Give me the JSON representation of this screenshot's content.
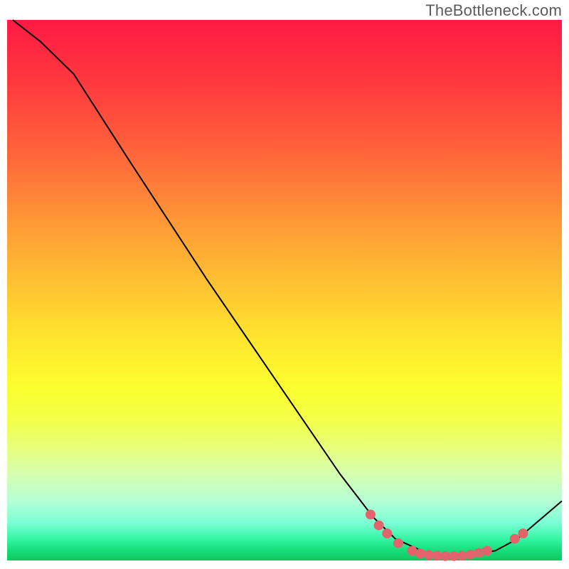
{
  "watermark": "TheBottleneck.com",
  "chart_data": {
    "type": "line",
    "title": "",
    "xlabel": "",
    "ylabel": "",
    "xlim": [
      0,
      100
    ],
    "ylim": [
      0,
      100
    ],
    "series": [
      {
        "name": "curve",
        "points": [
          {
            "x": 1,
            "y": 100
          },
          {
            "x": 6,
            "y": 96
          },
          {
            "x": 12,
            "y": 90
          },
          {
            "x": 17,
            "y": 82
          },
          {
            "x": 22,
            "y": 74
          },
          {
            "x": 29,
            "y": 63
          },
          {
            "x": 36,
            "y": 52
          },
          {
            "x": 44,
            "y": 40
          },
          {
            "x": 52,
            "y": 28
          },
          {
            "x": 60,
            "y": 16
          },
          {
            "x": 66,
            "y": 8
          },
          {
            "x": 70,
            "y": 4
          },
          {
            "x": 76,
            "y": 1.2
          },
          {
            "x": 82,
            "y": 0.8
          },
          {
            "x": 88,
            "y": 1.8
          },
          {
            "x": 92,
            "y": 4
          },
          {
            "x": 100,
            "y": 11
          }
        ]
      }
    ],
    "markers": [
      {
        "x": 65.5,
        "y": 8.5
      },
      {
        "x": 67.0,
        "y": 6.5
      },
      {
        "x": 68.5,
        "y": 5.0
      },
      {
        "x": 70.5,
        "y": 3.2
      },
      {
        "x": 73.0,
        "y": 1.8
      },
      {
        "x": 74.5,
        "y": 1.3
      },
      {
        "x": 76.0,
        "y": 1.0
      },
      {
        "x": 77.5,
        "y": 0.9
      },
      {
        "x": 79.0,
        "y": 0.8
      },
      {
        "x": 80.5,
        "y": 0.8
      },
      {
        "x": 82.0,
        "y": 0.9
      },
      {
        "x": 83.5,
        "y": 1.1
      },
      {
        "x": 85.0,
        "y": 1.4
      },
      {
        "x": 86.5,
        "y": 1.8
      },
      {
        "x": 91.5,
        "y": 4.0
      },
      {
        "x": 93.0,
        "y": 5.0
      }
    ],
    "marker_color": "#e2636b",
    "line_color": "#000000",
    "gradient_stops": [
      {
        "pos": 0.0,
        "color": "#ff1a44"
      },
      {
        "pos": 0.5,
        "color": "#ffe82e"
      },
      {
        "pos": 0.96,
        "color": "#35f5a3"
      },
      {
        "pos": 1.0,
        "color": "#0fc65f"
      }
    ]
  }
}
